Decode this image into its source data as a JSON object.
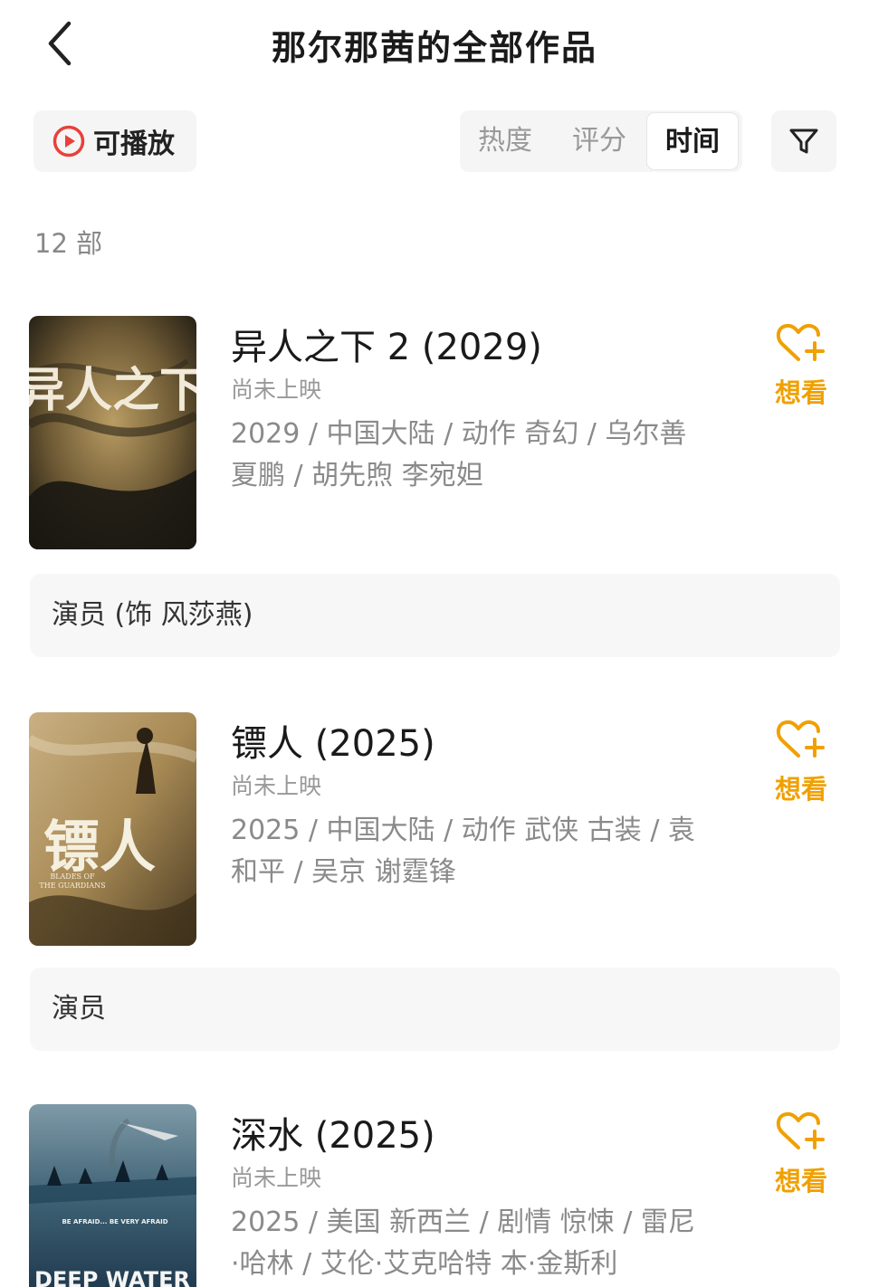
{
  "header": {
    "title": "那尔那茜的全部作品",
    "back_icon": "chevron-left-icon"
  },
  "filters": {
    "playable_label": "可播放",
    "playable_icon": "play-circle-icon",
    "sort_tabs": [
      {
        "label": "热度",
        "active": false
      },
      {
        "label": "评分",
        "active": false
      },
      {
        "label": "时间",
        "active": true
      }
    ],
    "filter_icon": "funnel-icon"
  },
  "count_label": "12 部",
  "colors": {
    "accent": "#f0a000",
    "play_red": "#e8413b",
    "muted": "#8a8a8a"
  },
  "works": [
    {
      "title": "异人之下 2 (2029)",
      "status": "尚未上映",
      "meta_line1": "2029 / 中国大陆 / 动作 奇幻 / 乌尔善",
      "meta_line2": "夏鹏 / 胡先煦 李宛妲",
      "want_label": "想看",
      "want_icon": "heart-plus-icon",
      "role": "演员 (饰 风莎燕)",
      "poster_text": "异人之下"
    },
    {
      "title": "镖人 (2025)",
      "status": "尚未上映",
      "meta_line1": "2025 / 中国大陆 / 动作 武侠 古装 / 袁",
      "meta_line2": "和平 / 吴京 谢霆锋",
      "want_label": "想看",
      "want_icon": "heart-plus-icon",
      "role": "演员",
      "poster_text": "镖人",
      "poster_subtext_1": "BLADES OF",
      "poster_subtext_2": "THE GUARDIANS"
    },
    {
      "title": "深水 (2025)",
      "status": "尚未上映",
      "meta_line1": "2025 / 美国 新西兰 / 剧情 惊悚 / 雷尼",
      "meta_line2": "·哈林 / 艾伦·艾克哈特 本·金斯利",
      "want_label": "想看",
      "want_icon": "heart-plus-icon",
      "poster_tagline": "BE AFRAID... BE VERY AFRAID",
      "poster_text": "DEEP WATER"
    }
  ]
}
